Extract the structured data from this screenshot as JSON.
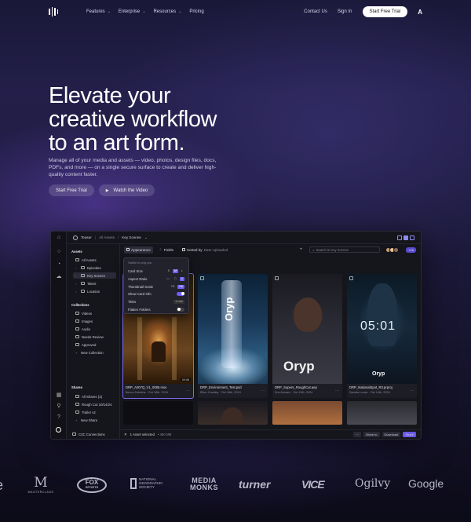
{
  "nav": {
    "links": [
      {
        "label": "Features",
        "has_menu": true
      },
      {
        "label": "Enterprise",
        "has_menu": true
      },
      {
        "label": "Resources",
        "has_menu": true
      },
      {
        "label": "Pricing",
        "has_menu": false
      }
    ],
    "contact": "Contact Us",
    "signin": "Sign In",
    "trial": "Start Free Trial",
    "adobe_icon": "adobe-icon"
  },
  "hero": {
    "title_lines": [
      "Elevate your",
      "creative workflow",
      "to an art form."
    ],
    "subtitle": "Manage all of your media and assets — video, photos, design files, docs, PDFs, and more — on a single secure surface to create and deliver high-quality content faster.",
    "cta_primary": "Start Free Trial",
    "cta_secondary": "Watch the Video"
  },
  "app": {
    "breadcrumb": [
      "Teaser",
      "All Assets",
      "Key Scenes"
    ],
    "toolbar": {
      "appearance": "Appearance",
      "fields": "Fields",
      "sorted": "Sorted by",
      "sorted_value": "Date Uploaded",
      "search_placeholder": "Search in Key Scenes",
      "avatar_count": "+26"
    },
    "assets_header": "Assets",
    "assets": [
      "All Assets",
      "Episodes",
      "Key Scenes",
      "Talent",
      "Location"
    ],
    "collections_header": "Collections",
    "collections": [
      "Videos",
      "Images",
      "Audio",
      "Needs Review",
      "Approved",
      "New Collection"
    ],
    "shares_header": "Shares",
    "shares": [
      "All Shares (2)",
      "Rough Cut 10/14/24",
      "Trailer v2",
      "New Share"
    ],
    "c2c": "C2C Connections",
    "popup": {
      "hint": "Visible to only you",
      "card_size": "Card Size",
      "card_size_opts": [
        "S",
        "M",
        "L"
      ],
      "aspect_ratio": "Aspect Ratio",
      "thumbnail_scale": "Thumbnail Scale",
      "scale_opts": [
        "Fit",
        "Fill"
      ],
      "show_card_info": "Show Card Info",
      "titles": "Titles",
      "titles_value": "1 Line",
      "flatten_folders": "Flatten Folders"
    },
    "cards": [
      {
        "name": "DRP_A007Q_V1_0085.mov",
        "owner": "Becca Dobbins",
        "date": "Oct 18th, 2024",
        "duration": "00:08"
      },
      {
        "name": "DRP_Environment_Test.psd",
        "owner": "Elton Crawley",
        "date": "Oct 16th, 2024"
      },
      {
        "name": "DRP_Supers_RoughCut.aep",
        "owner": "Eric Alvarez",
        "date": "Oct 15th, 2024"
      },
      {
        "name": "DRP_NationalSpot_R3.prproj",
        "owner": "Sandra Lucas",
        "date": "Oct 14th, 2024"
      }
    ],
    "bottom": {
      "selected": "1 Asset selected",
      "size": "450 MB",
      "move": "Move to",
      "download": "Download",
      "share": "Share"
    }
  },
  "logos": [
    "M",
    "MASTERCLASS",
    "FOX",
    "SPORTS",
    "NATIONAL",
    "GEOGRAPHIC",
    "SOCIETY",
    "MEDIA",
    "MONKS",
    "turner",
    "VICE",
    "Ogilvy",
    "Google"
  ],
  "colors": {
    "accent": "#6f5ff0",
    "bg_top": "#1a1838",
    "bg_bottom": "#0c0b18"
  }
}
